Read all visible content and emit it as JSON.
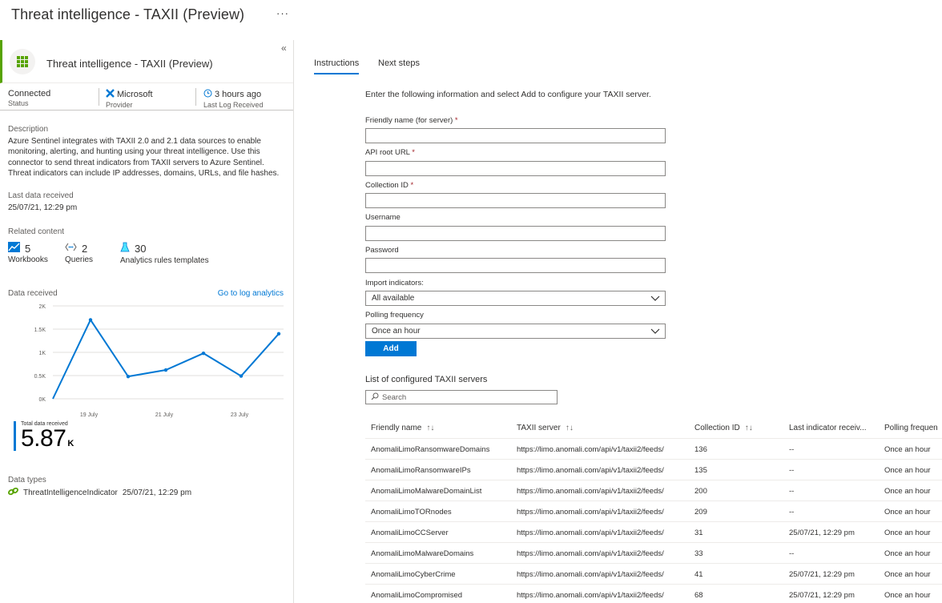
{
  "page": {
    "title": "Threat intelligence - TAXII (Preview)",
    "more": "···"
  },
  "connector": {
    "title": "Threat intelligence - TAXII (Preview)",
    "status_value": "Connected",
    "status_label": "Status",
    "provider_value": "Microsoft",
    "provider_label": "Provider",
    "log_value": "3 hours ago",
    "log_label": "Last Log Received",
    "description_label": "Description",
    "description": "Azure Sentinel integrates with TAXII 2.0 and 2.1 data sources to enable monitoring, alerting, and hunting using your threat intelligence. Use this connector to send threat indicators from TAXII servers to Azure Sentinel. Threat indicators can include IP addresses, domains, URLs, and file hashes.",
    "last_data_label": "Last data received",
    "last_data_value": "25/07/21, 12:29 pm",
    "related_label": "Related content",
    "related": [
      {
        "count": "5",
        "label": "Workbooks",
        "icon": "workbook-icon"
      },
      {
        "count": "2",
        "label": "Queries",
        "icon": "query-icon"
      },
      {
        "count": "30",
        "label": "Analytics rules templates",
        "icon": "flask-icon"
      }
    ],
    "data_received_label": "Data received",
    "go_to_log": "Go to log analytics",
    "total_caption": "Total data received",
    "total_value": "5.87",
    "total_unit": "K",
    "data_types_label": "Data types",
    "data_type_name": "ThreatIntelligenceIndicator",
    "data_type_time": "25/07/21, 12:29 pm",
    "colors": {
      "accent": "#0078d4",
      "connected": "#57a300"
    }
  },
  "chart_data": {
    "type": "line",
    "title": "",
    "y_ticks": [
      "2K",
      "1.5K",
      "1K",
      "0.5K",
      "0K"
    ],
    "ylim": [
      0,
      2000
    ],
    "x_ticks": [
      "19 July",
      "21 July",
      "23 July"
    ],
    "x": [
      "18 July",
      "19 July",
      "20 July",
      "21 July",
      "22 July",
      "23 July",
      "24 July"
    ],
    "series": [
      {
        "values": [
          0,
          1700,
          480,
          620,
          980,
          490,
          1400
        ]
      }
    ]
  },
  "tabs": [
    {
      "label": "Instructions"
    },
    {
      "label": "Next steps"
    }
  ],
  "form": {
    "intro": "Enter the following information and select Add to configure your TAXII server.",
    "friendly_label": "Friendly name (for server)",
    "api_label": "API root URL",
    "collection_label": "Collection ID",
    "username_label": "Username",
    "password_label": "Password",
    "import_label": "Import indicators:",
    "import_value": "All available",
    "polling_label": "Polling frequency",
    "polling_value": "Once an hour",
    "required_mark": "*",
    "add_button": "Add"
  },
  "servers": {
    "title": "List of configured TAXII servers",
    "search_placeholder": "Search",
    "columns": [
      "Friendly name",
      "TAXII server",
      "Collection ID",
      "Last indicator receiv...",
      "Polling frequen"
    ],
    "rows": [
      [
        "AnomaliLimoRansomwareDomains",
        "https://limo.anomali.com/api/v1/taxii2/feeds/",
        "136",
        "--",
        "Once an hour"
      ],
      [
        "AnomaliLimoRansomwareIPs",
        "https://limo.anomali.com/api/v1/taxii2/feeds/",
        "135",
        "--",
        "Once an hour"
      ],
      [
        "AnomaliLimoMalwareDomainList",
        "https://limo.anomali.com/api/v1/taxii2/feeds/",
        "200",
        "--",
        "Once an hour"
      ],
      [
        "AnomaliLimoTORnodes",
        "https://limo.anomali.com/api/v1/taxii2/feeds/",
        "209",
        "--",
        "Once an hour"
      ],
      [
        "AnomaliLimoCCServer",
        "https://limo.anomali.com/api/v1/taxii2/feeds/",
        "31",
        "25/07/21, 12:29 pm",
        "Once an hour"
      ],
      [
        "AnomaliLimoMalwareDomains",
        "https://limo.anomali.com/api/v1/taxii2/feeds/",
        "33",
        "--",
        "Once an hour"
      ],
      [
        "AnomaliLimoCyberCrime",
        "https://limo.anomali.com/api/v1/taxii2/feeds/",
        "41",
        "25/07/21, 12:29 pm",
        "Once an hour"
      ],
      [
        "AnomaliLimoCompromised",
        "https://limo.anomali.com/api/v1/taxii2/feeds/",
        "68",
        "25/07/21, 12:29 pm",
        "Once an hour"
      ]
    ]
  }
}
